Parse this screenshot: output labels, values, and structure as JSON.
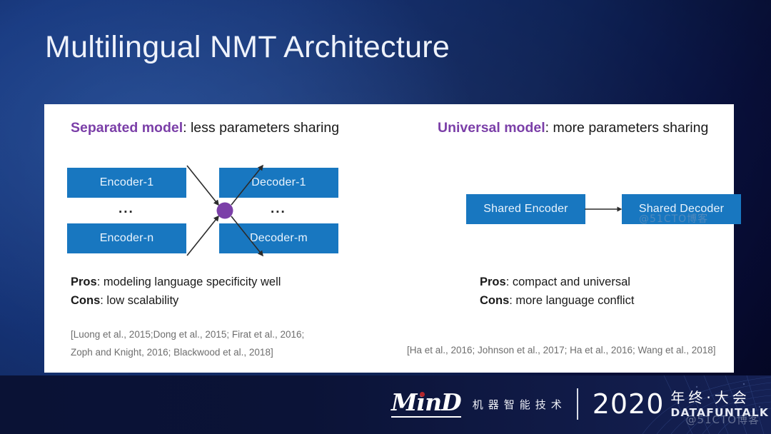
{
  "slide": {
    "title": "Multilingual NMT Architecture"
  },
  "left_panel": {
    "heading_accent": "Separated model",
    "heading_rest": ": less parameters sharing",
    "boxes": {
      "encoder_first": "Encoder-1",
      "encoder_last": "Encoder-n",
      "decoder_first": "Decoder-1",
      "decoder_last": "Decoder-m",
      "ellipsis_left": "...",
      "ellipsis_right": "..."
    },
    "pros_label": "Pros",
    "pros_text": ": modeling language specificity well",
    "cons_label": "Cons",
    "cons_text": ": low scalability",
    "citation_line1": "[Luong et al., 2015;Dong et al., 2015; Firat et al., 2016;",
    "citation_line2": "Zoph and Knight, 2016; Blackwood et al., 2018]"
  },
  "right_panel": {
    "heading_accent": "Universal model",
    "heading_rest": ": more parameters sharing",
    "boxes": {
      "shared_encoder": "Shared Encoder",
      "shared_decoder": "Shared Decoder"
    },
    "pros_label": "Pros",
    "pros_text": ": compact and universal",
    "cons_label": "Cons",
    "cons_text": ": more language conflict",
    "citation_line1": "[Ha et al., 2016; Johnson et al., 2017; Ha et al., 2016; Wang et al., 2018]"
  },
  "footer": {
    "logo_text": "MinD",
    "logo_cn": "机器智能技术",
    "year": "2020",
    "conference_cn": "年终·大会",
    "conference_en": "DATAFUNTALK",
    "watermark": "@51CTO博客",
    "watermark_mid": "@51CTO博客"
  },
  "colors": {
    "accent_purple": "#7b3fa8",
    "box_blue": "#1877c0",
    "card_white": "#ffffff",
    "hub_purple": "#7b3fa8",
    "title_text": "#eef2fb"
  }
}
